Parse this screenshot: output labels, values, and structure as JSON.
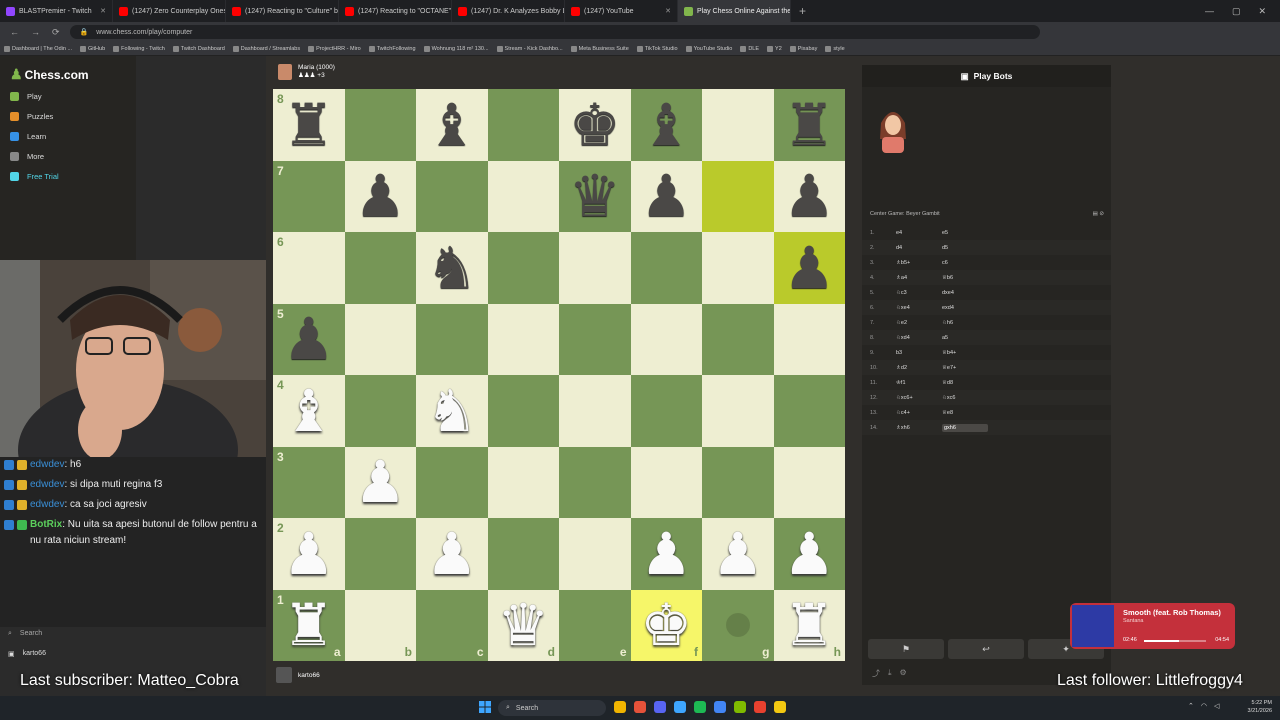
{
  "browser": {
    "tabs": [
      {
        "label": "BLASTPremier - Twitch",
        "color": "#9146ff"
      },
      {
        "label": "(1247) Zero Counterplay Onesh",
        "color": "#ff0000"
      },
      {
        "label": "(1247) Reacting to \"Culture\" by",
        "color": "#ff0000"
      },
      {
        "label": "(1247) Reacting to \"OCTANE\" b",
        "color": "#ff0000"
      },
      {
        "label": "(1247) Dr. K Analyzes Bobby Le",
        "color": "#ff0000"
      },
      {
        "label": "(1247) YouTube",
        "color": "#ff0000"
      },
      {
        "label": "Play Chess Online Against the C",
        "color": "#81b64c",
        "active": true
      }
    ],
    "url": "www.chess.com/play/computer",
    "bookmarks": [
      "Dashboard | The Odin ...",
      "GitHub",
      "Following - Twitch",
      "Twitch Dashboard",
      "Dashboard / Streamlabs",
      "ProjectHRR - Miro",
      "TwitchFollowing",
      "Wohnung 118 m² 130...",
      "Stream - Kick Dashbo...",
      "Meta Business Suite",
      "TikTok Studio",
      "YouTube Studio",
      "DLE",
      "Y2",
      "Pixabay",
      "style"
    ]
  },
  "sidebar": {
    "logo": "Chess.com",
    "items": [
      {
        "label": "Play",
        "color": "#81b64c"
      },
      {
        "label": "Puzzles",
        "color": "#e58f2a"
      },
      {
        "label": "Learn",
        "color": "#3692e7"
      },
      {
        "label": "More",
        "color": "#888888"
      },
      {
        "label": "Free Trial",
        "color": "#52d6e8"
      }
    ],
    "search": "Search",
    "username": "karto66"
  },
  "chat": [
    {
      "user": "edwdev",
      "text": ": h6",
      "bot": false
    },
    {
      "user": "edwdev",
      "text": ": si dipa muti regina f3",
      "bot": false
    },
    {
      "user": "edwdev",
      "text": ": ca sa joci agresiv",
      "bot": false
    },
    {
      "user": "BotRix",
      "text": ": Nu uita sa apesi butonul de follow pentru a nu rata niciun stream!",
      "bot": true
    }
  ],
  "overlays": {
    "subscriber": "Last subscriber: Matteo_Cobra",
    "follower": "Last follower: Littlefroggy4"
  },
  "opponent": {
    "name": "Maria",
    "rating": "(1000)",
    "captured": "+3"
  },
  "player": {
    "name": "karto66"
  },
  "board": {
    "ranks": [
      [
        "r",
        "",
        "b",
        "",
        "k",
        "b",
        "",
        "r"
      ],
      [
        "",
        "p",
        "",
        "",
        "q",
        "p",
        "",
        "p"
      ],
      [
        "",
        "",
        "n",
        "",
        "",
        "",
        "",
        "p"
      ],
      [
        "p",
        "",
        "",
        "",
        "",
        "",
        "",
        ""
      ],
      [
        "B",
        "",
        "N",
        "",
        "",
        "",
        "",
        ""
      ],
      [
        "",
        "P",
        "",
        "",
        "",
        "",
        "",
        ""
      ],
      [
        "P",
        "",
        "P",
        "",
        "",
        "P",
        "P",
        "P"
      ],
      [
        "R",
        "",
        "",
        "Q",
        "",
        "K",
        "",
        "R"
      ]
    ],
    "rank_labels": [
      "8",
      "7",
      "6",
      "5",
      "4",
      "3",
      "2",
      "1"
    ],
    "file_labels": [
      "a",
      "b",
      "c",
      "d",
      "e",
      "f",
      "g",
      "h"
    ],
    "highlights": [
      [
        1,
        6
      ],
      [
        2,
        7
      ],
      [
        7,
        5
      ]
    ],
    "move_dots": [
      [
        7,
        6
      ]
    ]
  },
  "panel": {
    "title": "Play Bots",
    "opening": "Center Game: Beyer Gambit",
    "moves": [
      {
        "n": "1.",
        "w": "e4",
        "b": "e5"
      },
      {
        "n": "2.",
        "w": "d4",
        "b": "d5"
      },
      {
        "n": "3.",
        "w": "♗b5+",
        "b": "c6"
      },
      {
        "n": "4.",
        "w": "♗a4",
        "b": "♕b6"
      },
      {
        "n": "5.",
        "w": "♘c3",
        "b": "dxe4"
      },
      {
        "n": "6.",
        "w": "♘xe4",
        "b": "exd4"
      },
      {
        "n": "7.",
        "w": "♘e2",
        "b": "♘h6"
      },
      {
        "n": "8.",
        "w": "♘xd4",
        "b": "a5"
      },
      {
        "n": "9.",
        "w": "b3",
        "b": "♕b4+"
      },
      {
        "n": "10.",
        "w": "♗d2",
        "b": "♕e7+"
      },
      {
        "n": "11.",
        "w": "♔f1",
        "b": "♕d8"
      },
      {
        "n": "12.",
        "w": "♘xc6+",
        "b": "♘xc6"
      },
      {
        "n": "13.",
        "w": "♘c4+",
        "b": "♕e8"
      },
      {
        "n": "14.",
        "w": "♗xh6",
        "b": "gxh6"
      }
    ]
  },
  "music": {
    "title": "Smooth (feat. Rob Thomas)",
    "artist": "Santana",
    "elapsed": "02:46",
    "total": "04:54",
    "progress": 0.57
  },
  "taskbar": {
    "search": "Search",
    "time": "5:22 PM",
    "date": "3/21/2026",
    "icons": [
      "#f0b400",
      "#e5523a",
      "#5865f2",
      "#3ea6ff",
      "#1db954",
      "#4285f4",
      "#7fba00",
      "#e8412f",
      "#f2c811"
    ]
  }
}
